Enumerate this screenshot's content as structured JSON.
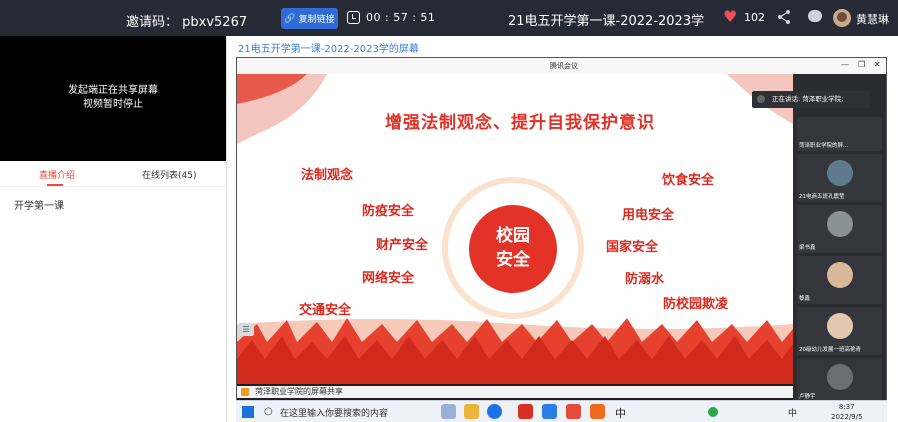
{
  "topbar": {
    "invite": "邀请码： pbxv5267",
    "copy_label": "复制链接",
    "timer": "00 : 57 : 51",
    "title": "21电五开学第一课-2022-2023学",
    "likes": "102",
    "username": "黄慧琳",
    "heart_color": "#f24d5e"
  },
  "left_video": {
    "line1": "发起端正在共享屏幕",
    "line2": "视频暂时停止"
  },
  "tabs": {
    "intro": "直播介绍",
    "list": "在线列表(45)"
  },
  "intro_text": "开学第一课",
  "share_title": "21电五开学第一课-2022-2023学的屏幕",
  "meeting": {
    "window_title": "腾讯会议",
    "speaking": "正在讲话: 菏泽职业学院;",
    "share_strip": "菏泽职业学院的屏幕共享",
    "slide": {
      "heading": "增强法制观念、提升自我保护意识",
      "center_line1": "校园",
      "center_line2": "安全",
      "accent": "#e23025",
      "topics_left": [
        "法制观念",
        "防疫安全",
        "财产安全",
        "网络安全",
        "交通安全"
      ],
      "topics_right": [
        "饮食安全",
        "用电安全",
        "国家安全",
        "防溺水",
        "防校园欺凌"
      ]
    },
    "participants": [
      "菏泽职业学院的屏...",
      "21电商五班孔震莹",
      "梁书鑫",
      "黎鑫",
      "20级幼儿发展一班高艳青",
      "卢静宇"
    ]
  },
  "taskbar": {
    "search_placeholder": "在这里输入你要搜索的内容",
    "ime": "中",
    "time": "8:37",
    "date": "2022/9/5"
  }
}
